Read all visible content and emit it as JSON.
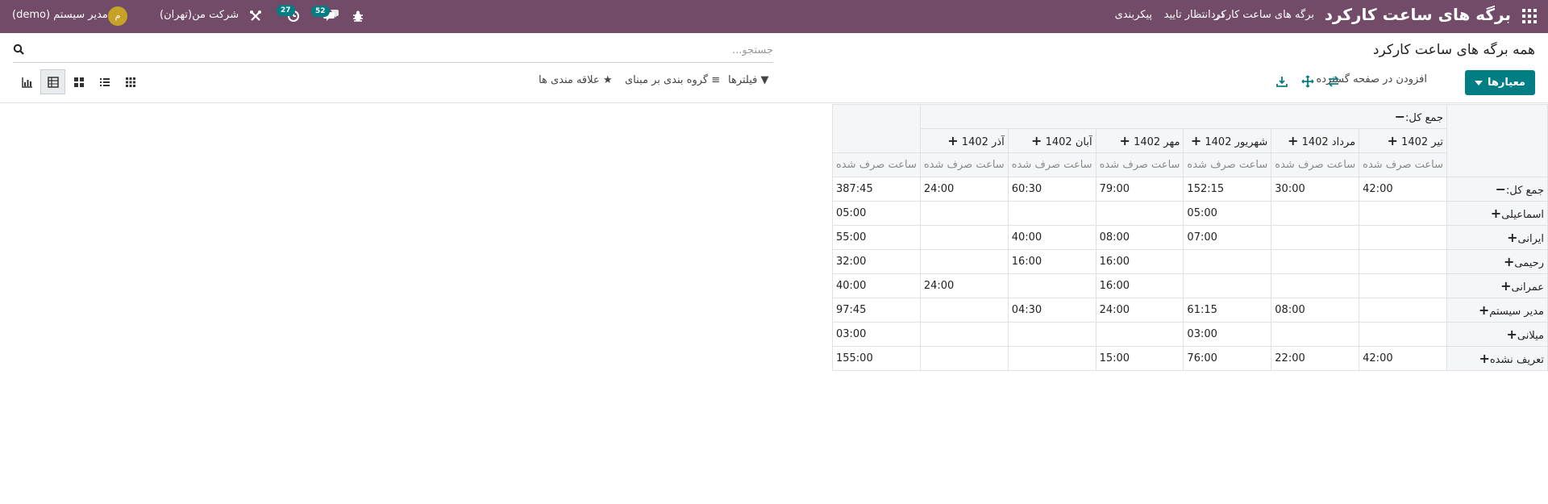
{
  "navbar": {
    "brand": "برگه های ساعت کارکرد",
    "menu": [
      "برگه های ساعت کارکرد",
      "در انتظار تایید",
      "پیکربندی"
    ],
    "chat_badge": "52",
    "activity_badge": "27",
    "company": "شرکت من(تهران)",
    "user_name": "مدیر سیستم (demo)",
    "avatar_letter": "م",
    "bar_color": "#714b67"
  },
  "control": {
    "breadcrumb": "همه برگه های ساعت کارکرد",
    "search_placeholder": "جستجو...",
    "measures_label": "معیارها",
    "expand_label": "افزودن در صفحه گسترده",
    "filters_label": "فیلترها",
    "groupby_label": "گروه بندی بر مبنای",
    "favorites_label": "علاقه مندی ها",
    "accent": "#017e84"
  },
  "pivot": {
    "total_label": "جمع کل:",
    "measure_label": "ساعت صرف شده",
    "columns": [
      "تیر 1402",
      "مرداد 1402",
      "شهریور 1402",
      "مهر 1402",
      "آبان 1402",
      "آذر 1402"
    ],
    "total_row": [
      "42:00",
      "30:00",
      "152:15",
      "79:00",
      "60:30",
      "24:00",
      "387:45"
    ],
    "rows": [
      {
        "name": "اسماعیلی",
        "values": [
          "",
          "",
          "05:00",
          "",
          "",
          "",
          "05:00"
        ]
      },
      {
        "name": "ایرانی",
        "values": [
          "",
          "",
          "07:00",
          "08:00",
          "40:00",
          "",
          "55:00"
        ]
      },
      {
        "name": "رحیمی",
        "values": [
          "",
          "",
          "",
          "16:00",
          "16:00",
          "",
          "32:00"
        ]
      },
      {
        "name": "عمرانی",
        "values": [
          "",
          "",
          "",
          "16:00",
          "",
          "24:00",
          "40:00"
        ]
      },
      {
        "name": "مدیر سیستم",
        "values": [
          "",
          "08:00",
          "61:15",
          "24:00",
          "04:30",
          "",
          "97:45"
        ]
      },
      {
        "name": "میلانی",
        "values": [
          "",
          "",
          "03:00",
          "",
          "",
          "",
          "03:00"
        ]
      },
      {
        "name": "تعریف نشده",
        "values": [
          "42:00",
          "22:00",
          "76:00",
          "15:00",
          "",
          "",
          "155:00"
        ]
      }
    ]
  }
}
